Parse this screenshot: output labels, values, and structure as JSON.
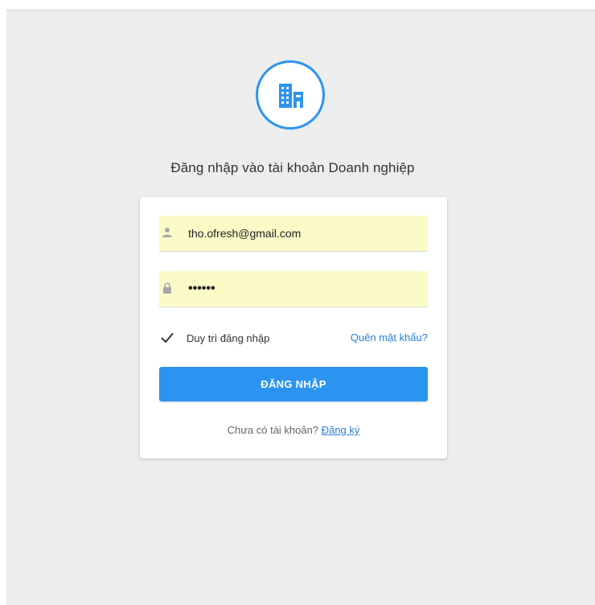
{
  "heading": "Đăng nhập vào tài khoản Doanh nghiệp",
  "logo": {
    "icon": "building-icon",
    "color": "#2b94f0"
  },
  "login_form": {
    "email": {
      "value": "tho.ofresh@gmail.com",
      "icon": "user-icon"
    },
    "password": {
      "value": "••••••",
      "icon": "lock-icon"
    },
    "remember_label": "Duy trì đăng nhập",
    "remember_checked": true,
    "forgot_link": "Quên mật khẩu?",
    "submit_label": "ĐĂNG NHẬP",
    "signup_prompt": "Chưa có tài khoản?",
    "signup_link": "Đăng ký"
  },
  "colors": {
    "accent": "#2b94f0",
    "link": "#2a7fd4",
    "autofill": "#fbfbc8",
    "background": "#ededed"
  }
}
